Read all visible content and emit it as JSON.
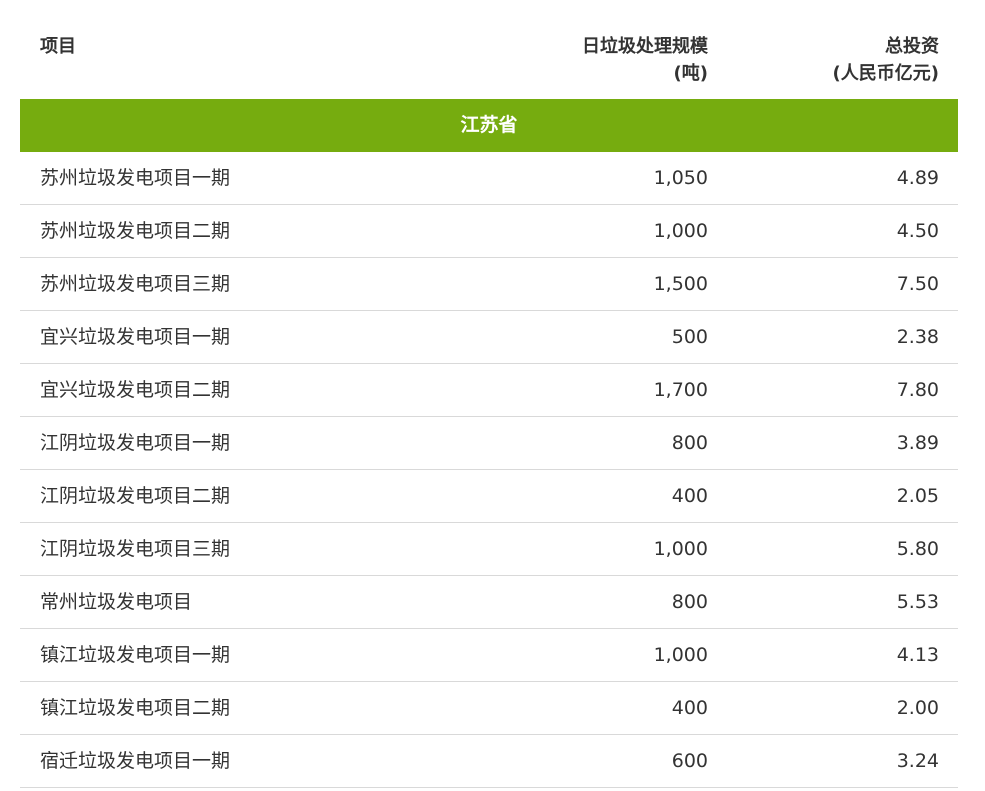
{
  "table": {
    "headers": {
      "name": "项目",
      "scale_line1": "日垃圾处理规模",
      "scale_line2": "(吨)",
      "invest_line1": "总投资",
      "invest_line2": "(人民币亿元)"
    },
    "section": "江苏省",
    "rows": [
      {
        "name": "苏州垃圾发电项目一期",
        "scale": "1,050",
        "invest": "4.89"
      },
      {
        "name": "苏州垃圾发电项目二期",
        "scale": "1,000",
        "invest": "4.50"
      },
      {
        "name": "苏州垃圾发电项目三期",
        "scale": "1,500",
        "invest": "7.50"
      },
      {
        "name": "宜兴垃圾发电项目一期",
        "scale": "500",
        "invest": "2.38"
      },
      {
        "name": "宜兴垃圾发电项目二期",
        "scale": "1,700",
        "invest": "7.80"
      },
      {
        "name": "江阴垃圾发电项目一期",
        "scale": "800",
        "invest": "3.89"
      },
      {
        "name": "江阴垃圾发电项目二期",
        "scale": "400",
        "invest": "2.05"
      },
      {
        "name": "江阴垃圾发电项目三期",
        "scale": "1,000",
        "invest": "5.80"
      },
      {
        "name": "常州垃圾发电项目",
        "scale": "800",
        "invest": "5.53"
      },
      {
        "name": "镇江垃圾发电项目一期",
        "scale": "1,000",
        "invest": "4.13"
      },
      {
        "name": "镇江垃圾发电项目二期",
        "scale": "400",
        "invest": "2.00"
      },
      {
        "name": "宿迁垃圾发电项目一期",
        "scale": "600",
        "invest": "3.24"
      }
    ]
  },
  "colors": {
    "section_bg": "#76ac0f",
    "text": "#333333",
    "divider": "#d9d9d9"
  }
}
